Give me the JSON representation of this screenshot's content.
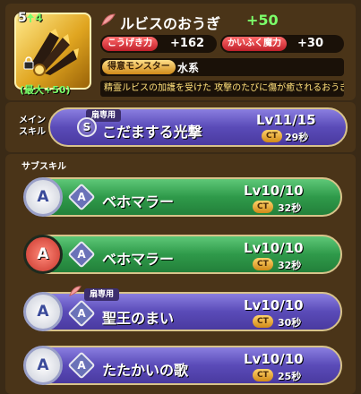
{
  "weapon": {
    "rank": "5",
    "plus": "4",
    "max_label": "(最大+50)",
    "name": "ルビスのおうぎ",
    "name_plus": "+50",
    "icon": "fan-weapon-icon"
  },
  "stats": [
    {
      "label": "こうげき力",
      "value": "+162"
    },
    {
      "label": "かいふく魔力",
      "value": "+30"
    }
  ],
  "tokui": {
    "label": "得意モンスター",
    "value": "水系"
  },
  "description": "精霊ルビスの加護を受けた 攻撃のたびに傷が癒されるおうぎ",
  "main_skill": {
    "section_label_line1": "メイン",
    "section_label_line2": "スキル",
    "badge": "扇専用",
    "rank_icon": "S",
    "name": "こだまする光撃",
    "level": "Lv11/15",
    "ct_label": "CT",
    "ct_value": "29秒"
  },
  "sub_skills_header": "サブスキル",
  "sub_skills": [
    {
      "left": "A",
      "rank": "A",
      "name": "ベホマラー",
      "level": "Lv10/10",
      "ct_label": "CT",
      "ct_value": "32秒",
      "badge": "",
      "color": "green"
    },
    {
      "left": "A",
      "rank": "A",
      "name": "ベホマラー",
      "level": "Lv10/10",
      "ct_label": "CT",
      "ct_value": "32秒",
      "badge": "",
      "color": "green"
    },
    {
      "left": "A",
      "rank": "A",
      "name": "聖王のまい",
      "level": "Lv10/10",
      "ct_label": "CT",
      "ct_value": "30秒",
      "badge": "扇専用",
      "color": "purple"
    },
    {
      "left": "A",
      "rank": "A",
      "name": "たたかいの歌",
      "level": "Lv10/10",
      "ct_label": "CT",
      "ct_value": "25秒",
      "badge": "",
      "color": "purple"
    }
  ]
}
